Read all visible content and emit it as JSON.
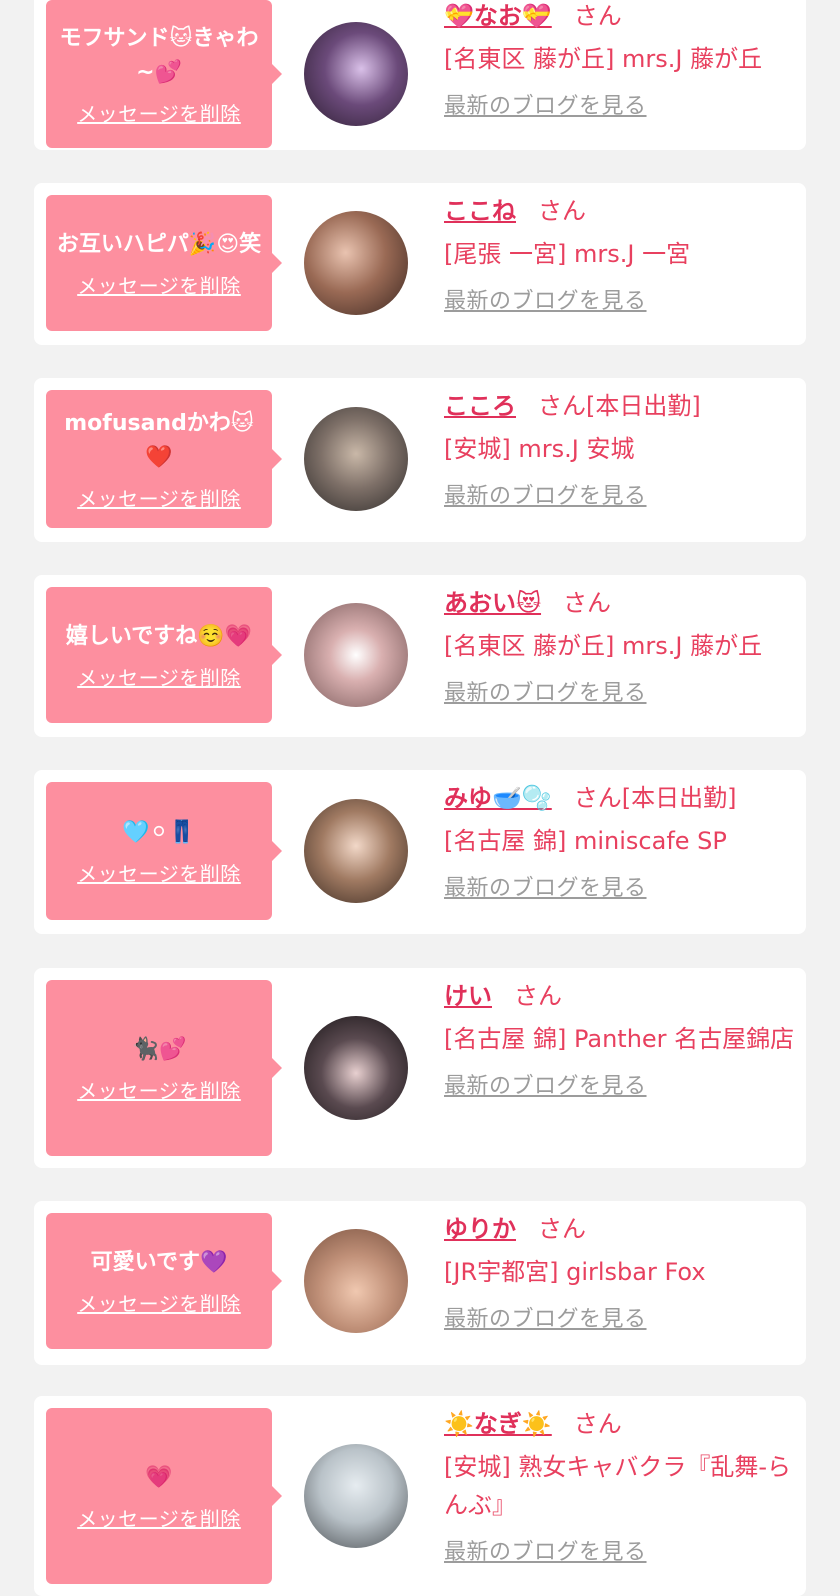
{
  "delete_label": "メッセージを削除",
  "blog_label": "最新のブログを見る",
  "san_label": "さん",
  "colors": {
    "bubble": "#fd8f9f",
    "name": "#e0305a",
    "text": "#e8405f",
    "link_gray": "#9c9c9c",
    "background": "#f2f2f2"
  },
  "entries": [
    {
      "message": "モフサンド🐱きゃわ~💕",
      "name": "💝なお💝",
      "badge": "",
      "shop": "[名東区 藤が丘] mrs.J 藤が丘"
    },
    {
      "message": "お互いハピパ🎉😍笑",
      "name": "ここね",
      "badge": "",
      "shop": "[尾張 一宮] mrs.J 一宮"
    },
    {
      "message": "mofusandかわ🐱❤️",
      "name": "こころ",
      "badge": "[本日出勤]",
      "shop": "[安城] mrs.J 安城"
    },
    {
      "message": "嬉しいですね☺️💗",
      "name": "あおい😻",
      "badge": "",
      "shop": "[名東区 藤が丘] mrs.J 藤が丘"
    },
    {
      "message": "🩵⚪👖",
      "name": "みゆ🥣🫧",
      "badge": "[本日出勤]",
      "shop": "[名古屋 錦] miniscafe SP"
    },
    {
      "message": "🐈‍⬛💕",
      "name": "けい",
      "badge": "",
      "shop": "[名古屋 錦] Panther 名古屋錦店"
    },
    {
      "message": "可愛いです💜",
      "name": "ゆりか",
      "badge": "",
      "shop": "[JR宇都宮] girlsbar Fox"
    },
    {
      "message": "💗",
      "name": "☀️なぎ☀️",
      "badge": "",
      "shop": "[安城] 熟女キャバクラ『乱舞-らんぶ』"
    }
  ]
}
